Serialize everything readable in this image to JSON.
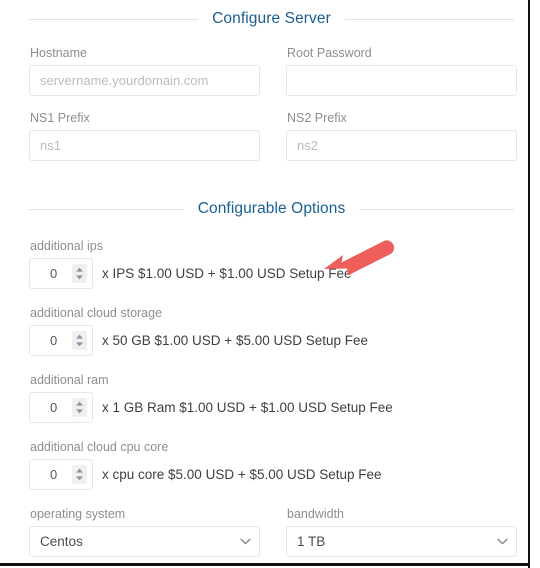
{
  "sections": {
    "configure_server": {
      "title": "Configure Server",
      "fields": [
        {
          "label": "Hostname",
          "value": "",
          "placeholder": "servername.yourdomain.com",
          "name": "hostname"
        },
        {
          "label": "Root Password",
          "value": "",
          "placeholder": "",
          "name": "root-password"
        },
        {
          "label": "NS1 Prefix",
          "value": "",
          "placeholder": "ns1",
          "name": "ns1-prefix"
        },
        {
          "label": "NS2 Prefix",
          "value": "",
          "placeholder": "ns2",
          "name": "ns2-prefix"
        }
      ]
    },
    "configurable_options": {
      "title": "Configurable Options",
      "quantity_options": [
        {
          "label": "additional ips",
          "value": "0",
          "description": "x IPS $1.00 USD + $1.00 USD Setup Fee",
          "unit_price": "$1.00 USD",
          "setup_fee": "$1.00 USD"
        },
        {
          "label": "additional cloud storage",
          "value": "0",
          "description": "x 50 GB $1.00 USD + $5.00 USD Setup Fee",
          "unit_price": "$1.00 USD",
          "setup_fee": "$5.00 USD"
        },
        {
          "label": "additional ram",
          "value": "0",
          "description": "x 1 GB Ram $1.00 USD + $1.00 USD Setup Fee",
          "unit_price": "$1.00 USD",
          "setup_fee": "$1.00 USD"
        },
        {
          "label": "additional cloud cpu core",
          "value": "0",
          "description": "x cpu core $5.00 USD + $5.00 USD Setup Fee",
          "unit_price": "$5.00 USD",
          "setup_fee": "$5.00 USD"
        }
      ],
      "select_options": [
        {
          "label": "operating system",
          "selected": "Centos",
          "options": [
            "Centos"
          ]
        },
        {
          "label": "bandwidth",
          "selected": "1 TB",
          "options": [
            "1 TB"
          ]
        }
      ]
    }
  },
  "annotation": {
    "arrow": "red-left-arrow",
    "points_at": "x IPS $1.00 USD + $1.00 USD Setup Fee",
    "color": "#ee5f5b"
  },
  "colors": {
    "heading": "#1a5f92",
    "label": "#8e8e8e",
    "body_text": "#3c3f42",
    "border": "#e4e6e8",
    "placeholder": "#b9bcbe",
    "rule": "#e2e2e2",
    "annotation": "#ee5f5b",
    "frame": "#111111"
  },
  "icons": {
    "spinner": "spinner-up-down-icon",
    "caret": "chevron-down-icon"
  }
}
